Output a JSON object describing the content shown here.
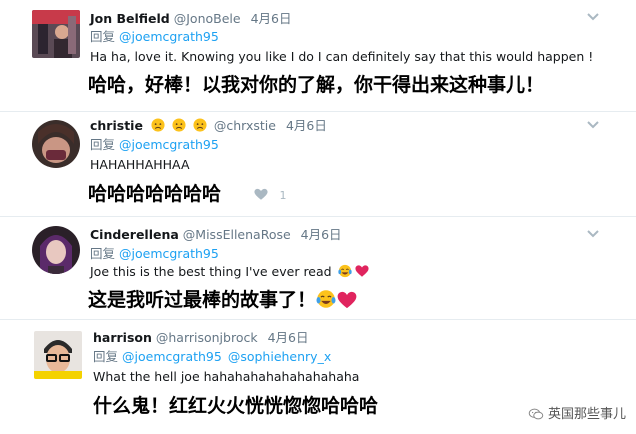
{
  "tweets": [
    {
      "name": "Jon Belfield",
      "handle": "@JonoBele",
      "time": "4月6日",
      "reply_prefix": "回复",
      "mentions": [
        "@joemcgrath95"
      ],
      "text": "Ha ha, love it. Knowing you like I do I can definitely say that this would happen !",
      "translation": "哈哈，好棒！以我对你的了解，你干得出来这种事儿！"
    },
    {
      "name": "christie",
      "name_emojis": [
        "disappointed-face",
        "disappointed-face",
        "disappointed-face"
      ],
      "handle": "@chrxstie",
      "time": "4月6日",
      "reply_prefix": "回复",
      "mentions": [
        "@joemcgrath95"
      ],
      "text": "HAHAHHAHHAA",
      "translation": "哈哈哈哈哈哈哈",
      "like_count": "1"
    },
    {
      "name": "Cinderellena",
      "handle": "@MissEllenaRose",
      "time": "4月6日",
      "reply_prefix": "回复",
      "mentions": [
        "@joemcgrath95"
      ],
      "text": "Joe this is the best thing I've ever read",
      "text_emojis": [
        "tears-of-joy",
        "red-heart"
      ],
      "translation": "这是我听过最棒的故事了！",
      "translation_emojis": [
        "tears-of-joy",
        "red-heart"
      ]
    },
    {
      "name": "harrison",
      "handle": "@harrisonjbrock",
      "time": "4月6日",
      "reply_prefix": "回复",
      "mentions": [
        "@joemcgrath95",
        "@sophiehenry_x"
      ],
      "text": "What the hell joe hahahahahahahahahaha",
      "translation": "什么鬼！红红火火恍恍惚惚哈哈哈"
    }
  ],
  "watermark": {
    "text": "英国那些事儿",
    "icon": "wechat-icon"
  },
  "colors": {
    "link": "#1da1f2",
    "muted": "#657786",
    "divider": "#e6ecf0",
    "heart": "#e0245e"
  }
}
